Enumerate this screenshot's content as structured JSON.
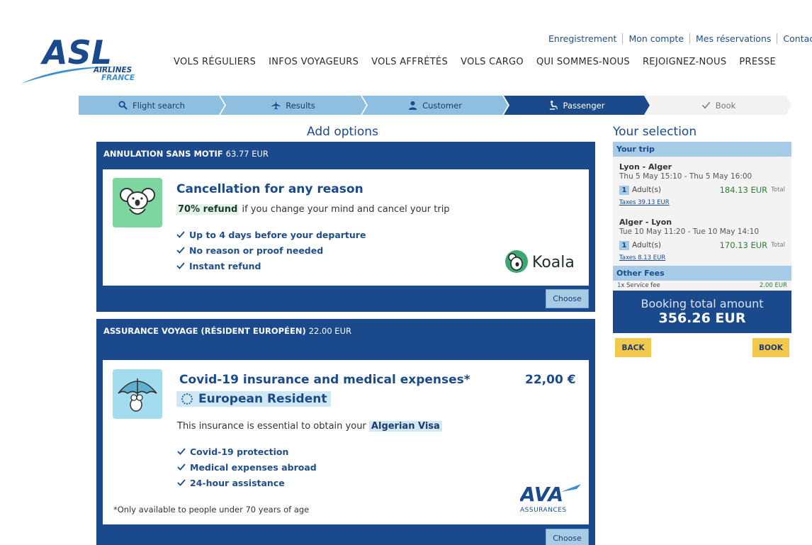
{
  "brand": {
    "name": "ASL",
    "line1": "AIRLINES",
    "line2": "FRANCE"
  },
  "top_links": [
    "Enregistrement",
    "Mon compte",
    "Mes réservations",
    "Contact"
  ],
  "main_nav": [
    "VOLS RÉGULIERS",
    "INFOS VOYAGEURS",
    "VOLS AFFRÉTÉS",
    "VOLS CARGO",
    "QUI SOMMES-NOUS",
    "REJOIGNEZ-NOUS",
    "PRESSE"
  ],
  "steps": [
    "Flight search",
    "Results",
    "Customer",
    "Passenger",
    "Book"
  ],
  "headings": {
    "add_options": "Add options",
    "your_selection": "Your selection"
  },
  "option1": {
    "title": "ANNULATION SANS MOTIF",
    "price": "63.77 EUR",
    "heading": "Cancellation for any reason",
    "highlight": "70% refund",
    "subtitle_rest": " if you change your mind and cancel your trip",
    "bullets": [
      "Up to 4 days before your departure",
      "No reason or proof needed",
      "Instant refund"
    ],
    "partner": "Koala",
    "choose": "Choose"
  },
  "option2": {
    "title": "ASSURANCE VOYAGE (RÉSIDENT EUROPÉEN)",
    "price": "22.00 EUR",
    "heading": "Covid-19 insurance and medical expenses*",
    "card_price": "22,00 €",
    "resident": "European Resident",
    "subtitle": "This insurance is essential to obtain your",
    "visa": "Algerian Visa",
    "bullets": [
      "Covid-19 protection",
      "Medical expenses abroad",
      "24-hour assistance"
    ],
    "footnote": "*Only available to people under 70 years of age",
    "partner": "AVA",
    "partner_sub": "ASSURANCES",
    "choose": "Choose"
  },
  "selection": {
    "trip_head": "Your trip",
    "legs": [
      {
        "route": "Lyon - Alger",
        "times": "Thu 5 May 15:10 - Thu 5 May 16:00",
        "count": "1",
        "pax": "Adult(s)",
        "amount": "184.13 EUR",
        "total_label": "Total",
        "taxes": "Taxes 39.13 EUR"
      },
      {
        "route": "Alger - Lyon",
        "times": "Tue 10 May 11:20 - Tue 10 May 14:10",
        "count": "1",
        "pax": "Adult(s)",
        "amount": "170.13 EUR",
        "total_label": "Total",
        "taxes": "Taxes 8.13 EUR"
      }
    ],
    "fees_head": "Other Fees",
    "fee_count": "1",
    "fee_label": " x Service fee",
    "fee_value": "2.00 EUR",
    "total_label": "Booking total amount",
    "total_value": "356.26 EUR",
    "back": "BACK",
    "book": "BOOK"
  },
  "colors": {
    "navy": "#1b4a8c",
    "light_blue": "#8fbfe0",
    "yellow": "#f2c94c",
    "green": "#2d7d32"
  }
}
